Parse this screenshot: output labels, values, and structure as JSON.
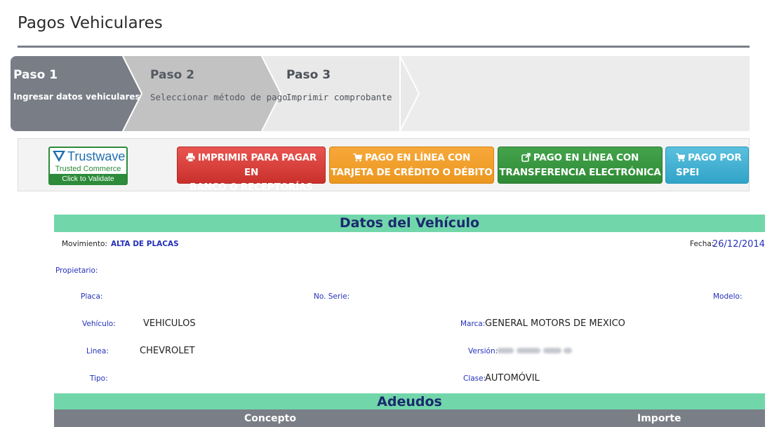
{
  "page": {
    "title": "Pagos Vehiculares"
  },
  "steps": [
    {
      "number": "Paso 1",
      "label": "Ingresar datos vehiculares",
      "active": true
    },
    {
      "number": "Paso 2",
      "label": "Seleccionar método de pago",
      "active": false
    },
    {
      "number": "Paso 3",
      "label": "Imprimir comprobante",
      "active": false
    }
  ],
  "trust_badge": {
    "name": "Trustwave",
    "subtitle": "Trusted Commerce",
    "action": "Click to Validate"
  },
  "payment_buttons": {
    "bank": {
      "line1": "IMPRIMIR PARA PAGAR EN",
      "line2": "BANCO O RECEPTORÍAS",
      "icon": "printer-icon",
      "color": "#d9534f"
    },
    "card": {
      "line1": "PAGO EN LÍNEA CON",
      "line2": "TARJETA DE CRÉDITO O DÉBITO",
      "icon": "shopping-cart-icon",
      "color": "#f0a030"
    },
    "transfer": {
      "line1": "PAGO EN LÍNEA CON",
      "line2": "TRANSFERENCIA ELECTRÓNICA",
      "icon": "external-link-icon",
      "color": "#3a9a41"
    },
    "spei": {
      "line1": "PAGO POR",
      "line2": "SPEI",
      "icon": "shopping-cart-icon",
      "color": "#46b8da"
    }
  },
  "vehicle": {
    "section_title": "Datos del Vehículo",
    "movimiento": {
      "label": "Movimiento:",
      "value": "ALTA DE PLACAS"
    },
    "fecha": {
      "label": "Fecha:",
      "value": "26/12/2014"
    },
    "propietario": {
      "label": "Propietario:",
      "value": ""
    },
    "placa": {
      "label": "Placa:",
      "value": ""
    },
    "no_serie": {
      "label": "No. Serie:",
      "value": ""
    },
    "modelo": {
      "label": "Modelo:",
      "value": ""
    },
    "vehiculo": {
      "label": "Vehículo:",
      "value": "VEHICULOS"
    },
    "marca": {
      "label": "Marca:",
      "value": "GENERAL MOTORS DE MEXICO"
    },
    "linea": {
      "label": "Linea:",
      "value": "CHEVROLET"
    },
    "version": {
      "label": "Versión:",
      "value": ""
    },
    "tipo": {
      "label": "Tipo:",
      "value": ""
    },
    "clase": {
      "label": "Clase:",
      "value": "AUTOMÓVIL"
    }
  },
  "debts": {
    "section_title": "Adeudos",
    "columns": [
      "Concepto",
      "Importe"
    ]
  },
  "colors": {
    "section_header": "#72d6ab",
    "section_title_text": "#1a2a6c",
    "label_blue": "#2430b8",
    "step_active": "#787d86",
    "step_2": "#c2c2c2",
    "step_3": "#e9e9e9"
  }
}
